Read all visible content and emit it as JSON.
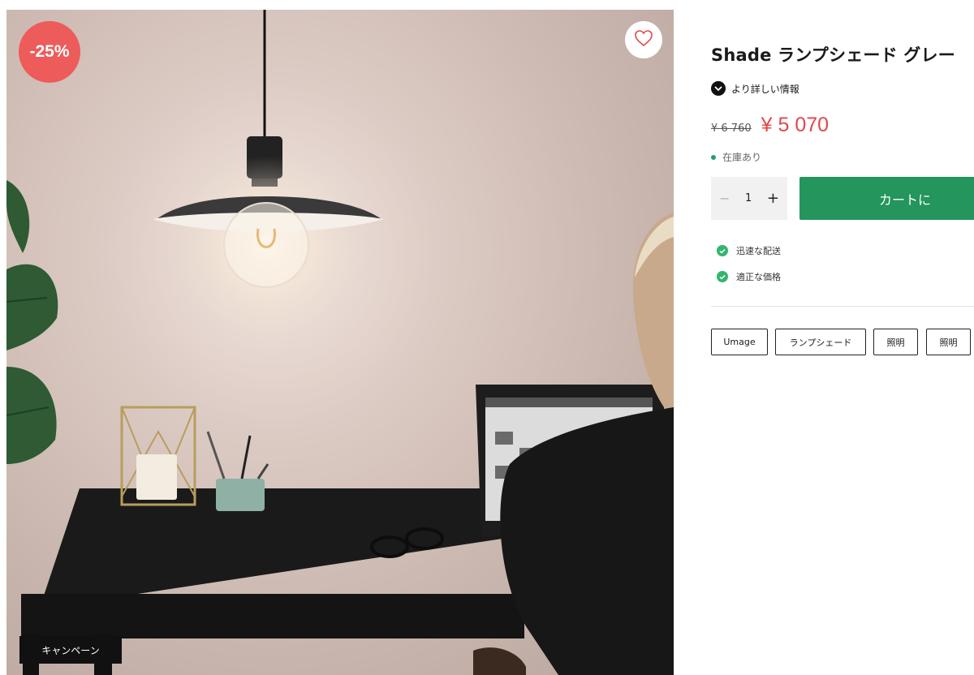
{
  "photo": {
    "discount_badge": "-25%",
    "campaign_label": "キャンペーン"
  },
  "product": {
    "title": "Shade ランプシェード グレー",
    "more_info_label": "より詳しい情報",
    "old_price": "¥ 6 760",
    "new_price": "¥ 5 070",
    "stock_status": "在庫あり",
    "quantity": "1",
    "add_to_cart_label": "カートに",
    "features": [
      "迅速な配送",
      "適正な価格"
    ],
    "tags": [
      "Umage",
      "ランプシェード",
      "照明",
      "照明"
    ]
  },
  "colors": {
    "discount": "#ee5b5b",
    "price": "#e0484b",
    "cart_button": "#24955c",
    "check": "#34b56e"
  },
  "icons": {
    "wishlist": "heart-outline-icon",
    "more_info": "chevron-down-icon",
    "feature": "check-circle-icon"
  }
}
